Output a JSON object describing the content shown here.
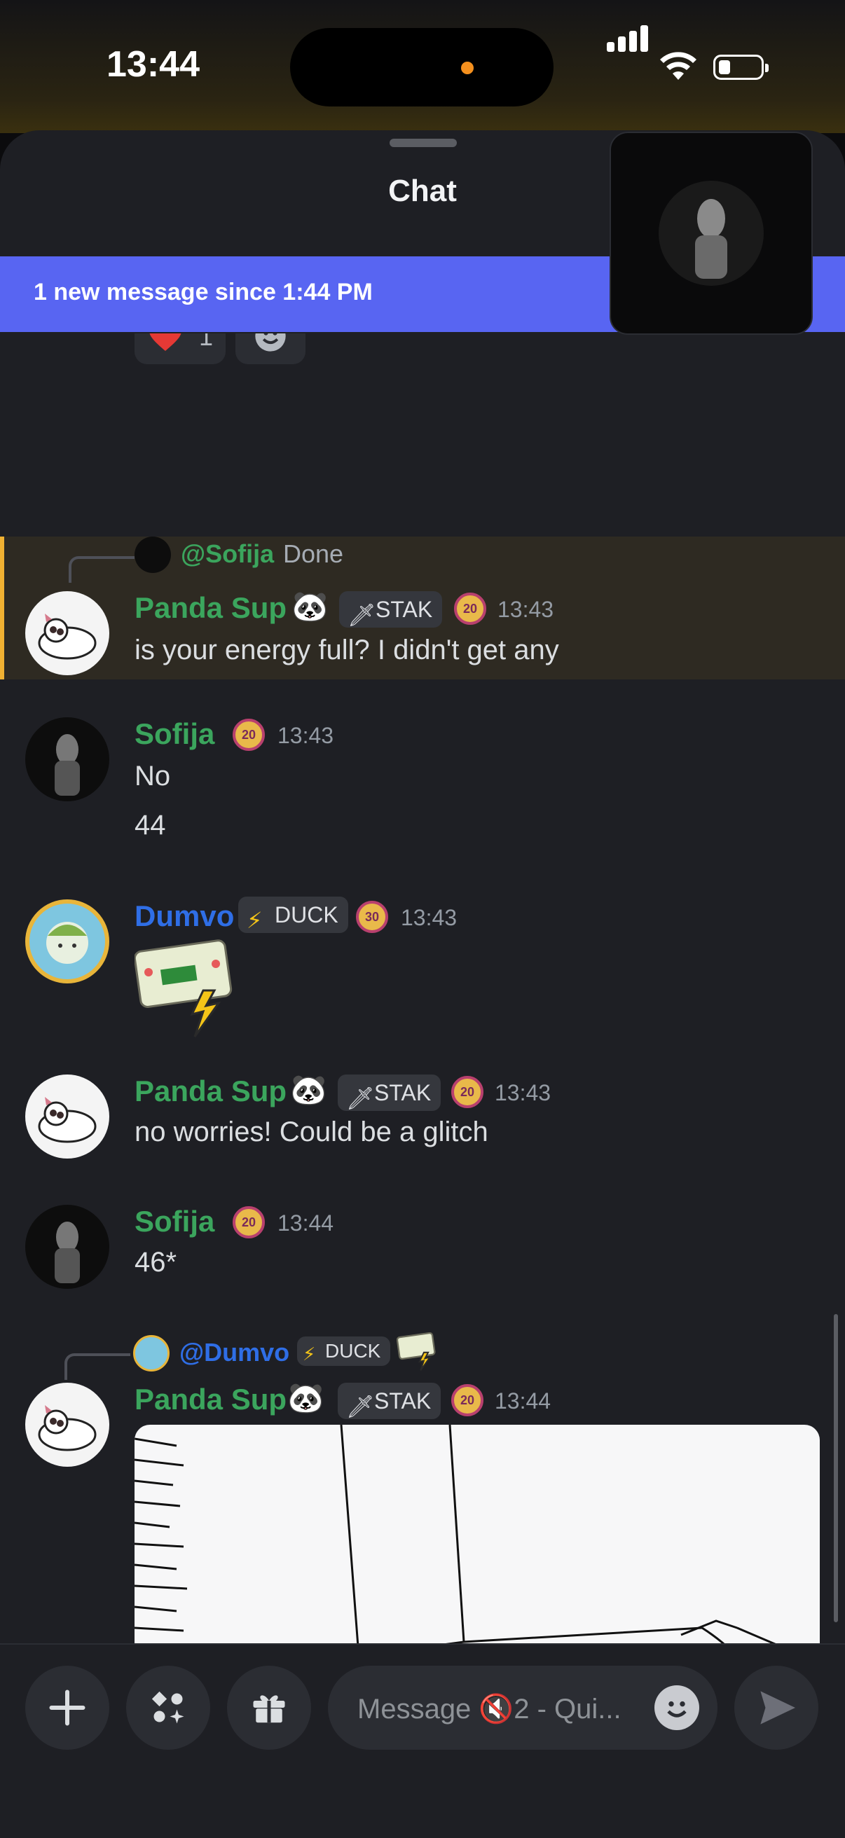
{
  "status_bar": {
    "time": "13:44"
  },
  "sheet": {
    "title": "Chat"
  },
  "new_messages_banner": "1 new message since 1:44 PM",
  "reactions": [
    {
      "emoji": "heart",
      "count": "1"
    },
    {
      "emoji": "add-reaction"
    }
  ],
  "messages": [
    {
      "reply_to": {
        "mention": "@Sofija",
        "text": "Done"
      },
      "author": "Panda Sup",
      "emoji_badge": "🐼",
      "tag": {
        "icon": "sword",
        "label": "STAK"
      },
      "level": "20",
      "time": "13:43",
      "lines": [
        "is your energy full? I didn't get any"
      ],
      "highlighted": true
    },
    {
      "author": "Sofija",
      "level": "20",
      "time": "13:43",
      "lines": [
        "No",
        "44"
      ]
    },
    {
      "author": "Dumvo",
      "tag": {
        "icon": "lightning",
        "label": "DUCK"
      },
      "level": "30",
      "time": "13:43",
      "sticker": "train-ticket-sticker"
    },
    {
      "author": "Panda Sup",
      "emoji_badge": "🐼",
      "tag": {
        "icon": "sword",
        "label": "STAK"
      },
      "level": "20",
      "time": "13:43",
      "lines": [
        "no worries! Could be a glitch"
      ]
    },
    {
      "author": "Sofija",
      "level": "20",
      "time": "13:44",
      "lines": [
        "46*"
      ]
    },
    {
      "reply_to": {
        "mention": "@Dumvo",
        "tag": {
          "icon": "lightning",
          "label": "DUCK"
        }
      },
      "author": "Panda Sup",
      "emoji_badge": "🐼",
      "tag": {
        "icon": "sword",
        "label": "STAK"
      },
      "level": "20",
      "time": "13:44",
      "attachment": "sketch-image"
    }
  ],
  "composer": {
    "placeholder": "Message 🔇2 - Qui..."
  },
  "colors": {
    "accent": "#5865f2",
    "name_green": "#3ba55d",
    "name_blue": "#2f6ee6",
    "highlight_bar": "#f0b132"
  }
}
